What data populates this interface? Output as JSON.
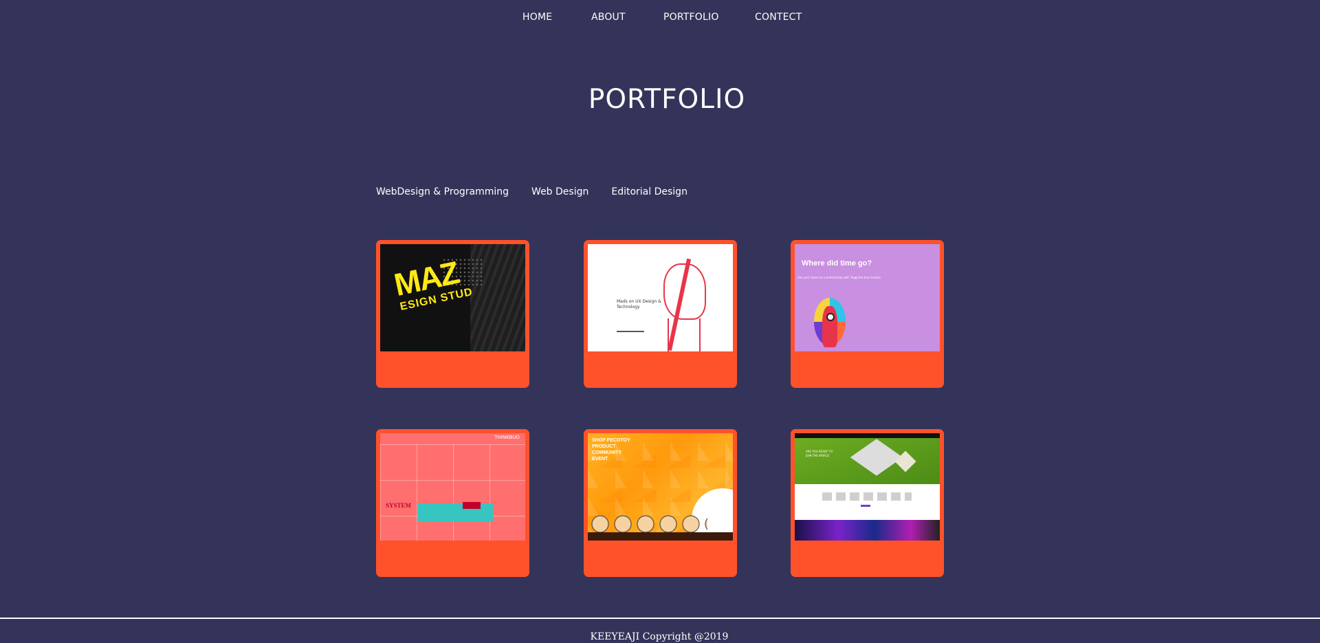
{
  "nav": {
    "items": [
      "HOME",
      "ABOUT",
      "PORTFOLIO",
      "CONTECT"
    ]
  },
  "page": {
    "title": "PORTFOLIO"
  },
  "filters": [
    "WebDesign & Programming",
    "Web Design",
    "Editorial Design"
  ],
  "cards": [
    {
      "name": "maz-design-studio",
      "thumb_text": "MAZ",
      "thumb_sub": "ESIGN STUD"
    },
    {
      "name": "ux-design-technology",
      "thumb_text": "Mads on UX Design & Technology"
    },
    {
      "name": "where-did-time-go",
      "thumb_text": "Where did time go?",
      "thumb_sub": "See your hours on a productivity wall. Toggl the time tracker"
    },
    {
      "name": "thinkbud",
      "thumb_text": "THINKBUD",
      "thumb_sub": "SYSTEM"
    },
    {
      "name": "pecotoy",
      "thumb_text": "SHOP PECOTOY PRODUCT COMMUNITY EVENT"
    },
    {
      "name": "isometric-game-site",
      "thumb_text": "ARE YOU READY TO JOIN THE WORLD"
    }
  ],
  "footer": {
    "text": "KEEYEAJI Copyright @2019"
  },
  "colors": {
    "background": "#34345a",
    "card": "#ff522b",
    "text": "#ffffff"
  }
}
